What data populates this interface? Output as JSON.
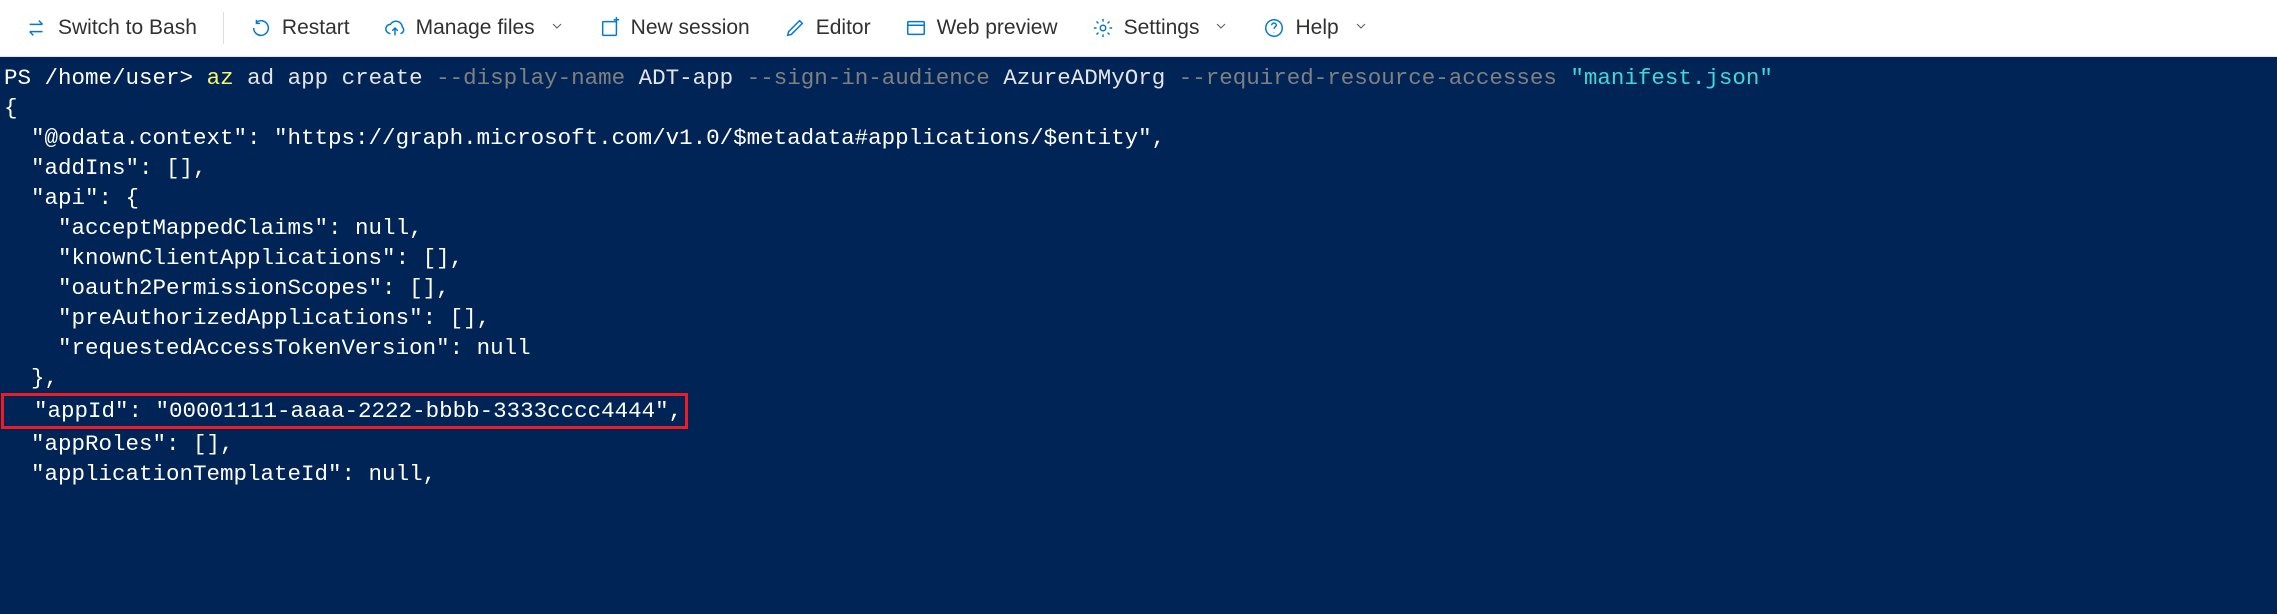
{
  "toolbar": {
    "switch_label": "Switch to Bash",
    "restart_label": "Restart",
    "manage_files_label": "Manage files",
    "new_session_label": "New session",
    "editor_label": "Editor",
    "web_preview_label": "Web preview",
    "settings_label": "Settings",
    "help_label": "Help"
  },
  "terminal": {
    "prompt_prefix": "PS ",
    "prompt_path": "/home/user>",
    "command": {
      "az": "az",
      "sub": " ad app create ",
      "flag1": "--display-name",
      "val1": " ADT-app ",
      "flag2": "--sign-in-audience",
      "val2": " AzureADMyOrg ",
      "flag3": "--required-resource-accesses",
      "val3": " \"manifest.json\""
    },
    "output_lines": {
      "l1": "{",
      "l2": "  \"@odata.context\": \"https://graph.microsoft.com/v1.0/$metadata#applications/$entity\",",
      "l3": "  \"addIns\": [],",
      "l4": "  \"api\": {",
      "l5": "    \"acceptMappedClaims\": null,",
      "l6": "    \"knownClientApplications\": [],",
      "l7": "    \"oauth2PermissionScopes\": [],",
      "l8": "    \"preAuthorizedApplications\": [],",
      "l9": "    \"requestedAccessTokenVersion\": null",
      "l10": "  },",
      "l11_hl": "  \"appId\": \"00001111-aaaa-2222-bbbb-3333cccc4444\",",
      "l12": "  \"appRoles\": [],",
      "l13": "  \"applicationTemplateId\": null,"
    }
  }
}
